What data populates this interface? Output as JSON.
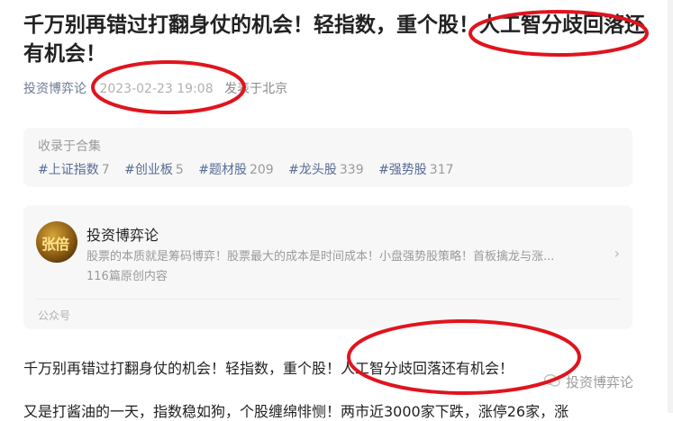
{
  "article": {
    "title": "千万别再错过打翻身仗的机会！轻指数，重个股！人工智分歧回落还有机会！",
    "author": "投资博弈论",
    "datetime": "2023-02-23 19:08",
    "location": "发表于北京"
  },
  "collection": {
    "caption": "收录于合集",
    "tags": [
      {
        "label": "#上证指数",
        "count": "7"
      },
      {
        "label": "#创业板",
        "count": "5"
      },
      {
        "label": "#题材股",
        "count": "209"
      },
      {
        "label": "#龙头股",
        "count": "339"
      },
      {
        "label": "#强势股",
        "count": "317"
      }
    ]
  },
  "profile": {
    "name": "投资博弈论",
    "description": "股票的本质就是筹码博弈！股票最大的成本是时间成本！小盘强势股策略！首板擒龙与涨...",
    "stats": "116篇原创内容",
    "footer": "公众号",
    "avatar_text": "张倍",
    "chevron": "›"
  },
  "body": {
    "line1": "千万别再错过打翻身仗的机会！轻指数，重个股！人工智分歧回落还有机会！",
    "line2": "又是打酱油的一天，指数稳如狗，个股缠绵悱恻！两市近3000家下跌，涨停26家，涨"
  },
  "watermark": {
    "text": "投资博弈论",
    "icon": "wechat-icon"
  },
  "colors": {
    "annotation": "#e0141e",
    "link": "#576b95",
    "muted": "#9a9a9a"
  }
}
